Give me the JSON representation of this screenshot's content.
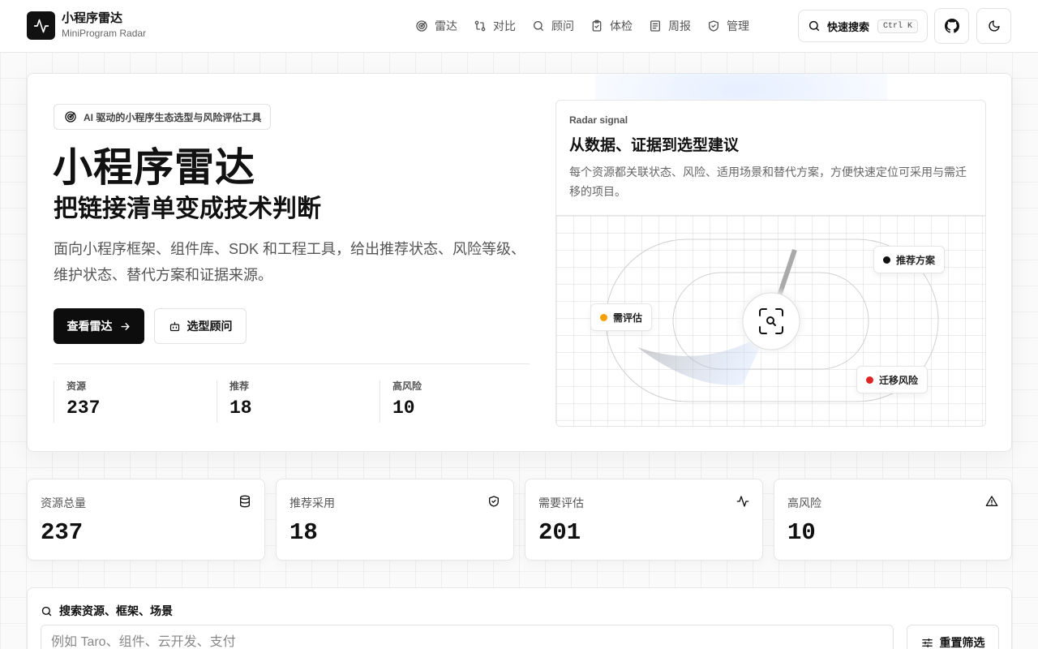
{
  "brand": {
    "title": "小程序雷达",
    "subtitle": "MiniProgram Radar",
    "icon": "activity-icon"
  },
  "nav": {
    "items": [
      {
        "label": "雷达",
        "icon": "radar-icon"
      },
      {
        "label": "对比",
        "icon": "git-compare-icon"
      },
      {
        "label": "顾问",
        "icon": "search-icon"
      },
      {
        "label": "体检",
        "icon": "clipboard-check-icon"
      },
      {
        "label": "周报",
        "icon": "newspaper-icon"
      },
      {
        "label": "管理",
        "icon": "shield-check-icon"
      }
    ],
    "search_label": "快速搜索",
    "search_shortcut": "Ctrl K"
  },
  "hero": {
    "badge": "AI 驱动的小程序生态选型与风险评估工具",
    "title": "小程序雷达",
    "subtitle": "把链接清单变成技术判断",
    "description": "面向小程序框架、组件库、SDK 和工程工具，给出推荐状态、风险等级、维护状态、替代方案和证据来源。",
    "primary_button": "查看雷达",
    "secondary_button": "选型顾问",
    "stats": [
      {
        "label": "资源",
        "value": "237"
      },
      {
        "label": "推荐",
        "value": "18"
      },
      {
        "label": "高风险",
        "value": "10"
      }
    ]
  },
  "radar_card": {
    "kicker": "Radar signal",
    "title": "从数据、证据到选型建议",
    "description": "每个资源都关联状态、风险、适用场景和替代方案，方便快速定位可采用与需迁移的项目。",
    "chips": [
      {
        "label": "推荐方案",
        "color": "#111111"
      },
      {
        "label": "需评估",
        "color": "#f5a000"
      },
      {
        "label": "迁移风险",
        "color": "#e02424"
      }
    ]
  },
  "stat_cards": [
    {
      "label": "资源总量",
      "value": "237",
      "icon": "database-icon"
    },
    {
      "label": "推荐采用",
      "value": "18",
      "icon": "shield-check-icon"
    },
    {
      "label": "需要评估",
      "value": "201",
      "icon": "activity-icon"
    },
    {
      "label": "高风险",
      "value": "10",
      "icon": "alert-triangle-icon"
    }
  ],
  "search_panel": {
    "title": "搜索资源、框架、场景",
    "placeholder": "例如 Taro、组件、云开发、支付",
    "reset_button": "重置筛选"
  }
}
